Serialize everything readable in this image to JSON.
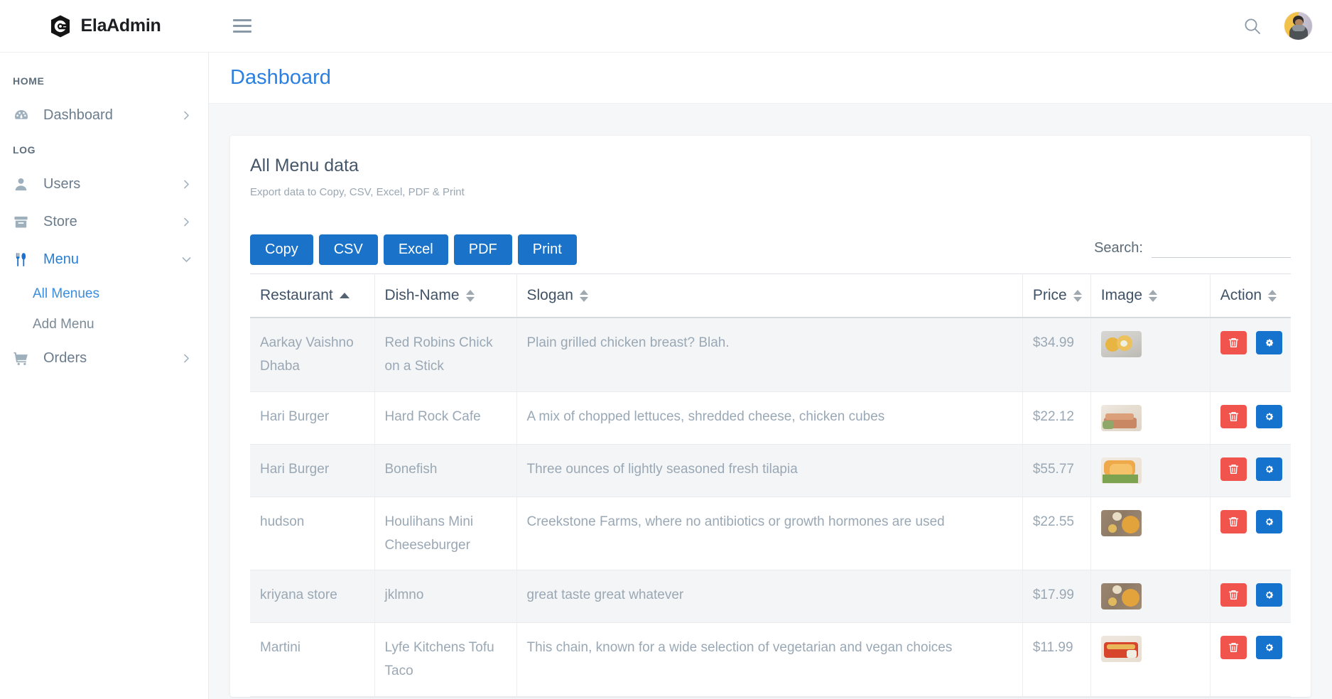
{
  "app": {
    "brand_name": "ElaAdmin",
    "logo_icon": "ela-logo-icon",
    "menu_toggle_icon": "hamburger-icon",
    "search_icon": "search-icon",
    "avatar_icon": "user-avatar"
  },
  "sidebar": {
    "sections": [
      {
        "label": "HOME",
        "items": [
          {
            "label": "Dashboard",
            "icon": "speedometer-icon",
            "chevron": "chevron-right-icon",
            "active": false
          }
        ]
      },
      {
        "label": "LOG",
        "items": [
          {
            "label": "Users",
            "icon": "user-icon",
            "chevron": "chevron-right-icon",
            "active": false
          },
          {
            "label": "Store",
            "icon": "box-icon",
            "chevron": "chevron-right-icon",
            "active": false
          },
          {
            "label": "Menu",
            "icon": "cutlery-icon",
            "chevron": "chevron-down-icon",
            "active": true,
            "children": [
              {
                "label": "All Menues",
                "active": true
              },
              {
                "label": "Add Menu",
                "active": false
              }
            ]
          },
          {
            "label": "Orders",
            "icon": "shopping-cart-icon",
            "chevron": "chevron-right-icon",
            "active": false
          }
        ]
      }
    ]
  },
  "page": {
    "title": "Dashboard"
  },
  "card": {
    "title": "All Menu data",
    "subtitle": "Export data to Copy, CSV, Excel, PDF & Print"
  },
  "toolbar": {
    "buttons": [
      {
        "label": "Copy"
      },
      {
        "label": "CSV"
      },
      {
        "label": "Excel"
      },
      {
        "label": "PDF"
      },
      {
        "label": "Print"
      }
    ],
    "search_label": "Search:",
    "search_value": "",
    "search_placeholder": ""
  },
  "table": {
    "columns": [
      {
        "label": "Restaurant",
        "sort": "asc"
      },
      {
        "label": "Dish-Name",
        "sort": "none"
      },
      {
        "label": "Slogan",
        "sort": "none"
      },
      {
        "label": "Price",
        "sort": "none"
      },
      {
        "label": "Image",
        "sort": "none"
      },
      {
        "label": "Action",
        "sort": "none"
      }
    ],
    "rows": [
      {
        "restaurant": "Aarkay Vaishno Dhaba",
        "dish": "Red Robins Chick on a Stick",
        "slogan": "Plain grilled chicken breast? Blah.",
        "price": "$34.99",
        "image_alt": "grilled-chicken-thumbnail",
        "delete_icon": "trash-icon",
        "edit_icon": "gear-icon"
      },
      {
        "restaurant": "Hari Burger",
        "dish": "Hard Rock Cafe",
        "slogan": "A mix of chopped lettuces, shredded cheese, chicken cubes",
        "price": "$22.12",
        "image_alt": "salmon-fillet-thumbnail",
        "delete_icon": "trash-icon",
        "edit_icon": "gear-icon"
      },
      {
        "restaurant": "Hari Burger",
        "dish": "Bonefish",
        "slogan": "Three ounces of lightly seasoned fresh tilapia",
        "price": "$55.77",
        "image_alt": "fried-shrimp-thumbnail",
        "delete_icon": "trash-icon",
        "edit_icon": "gear-icon"
      },
      {
        "restaurant": "hudson",
        "dish": "Houlihans Mini Cheeseburger",
        "slogan": "Creekstone Farms, where no antibiotics or growth hormones are used",
        "price": "$22.55",
        "image_alt": "pizza-table-thumbnail",
        "delete_icon": "trash-icon",
        "edit_icon": "gear-icon"
      },
      {
        "restaurant": "kriyana store",
        "dish": "jklmno",
        "slogan": "great taste great whatever",
        "price": "$17.99",
        "image_alt": "pizza-table-thumbnail",
        "delete_icon": "trash-icon",
        "edit_icon": "gear-icon"
      },
      {
        "restaurant": "Martini",
        "dish": "Lyfe Kitchens Tofu Taco",
        "slogan": "This chain, known for a wide selection of vegetarian and vegan choices",
        "price": "$11.99",
        "image_alt": "lasagna-plate-thumbnail",
        "delete_icon": "trash-icon",
        "edit_icon": "gear-icon"
      }
    ]
  },
  "colors": {
    "accent_blue": "#1a73c8",
    "link_blue": "#2a7fe0",
    "danger_red": "#f0544c",
    "page_bg": "#f6f7f9",
    "text_muted": "#9aa8b5"
  }
}
